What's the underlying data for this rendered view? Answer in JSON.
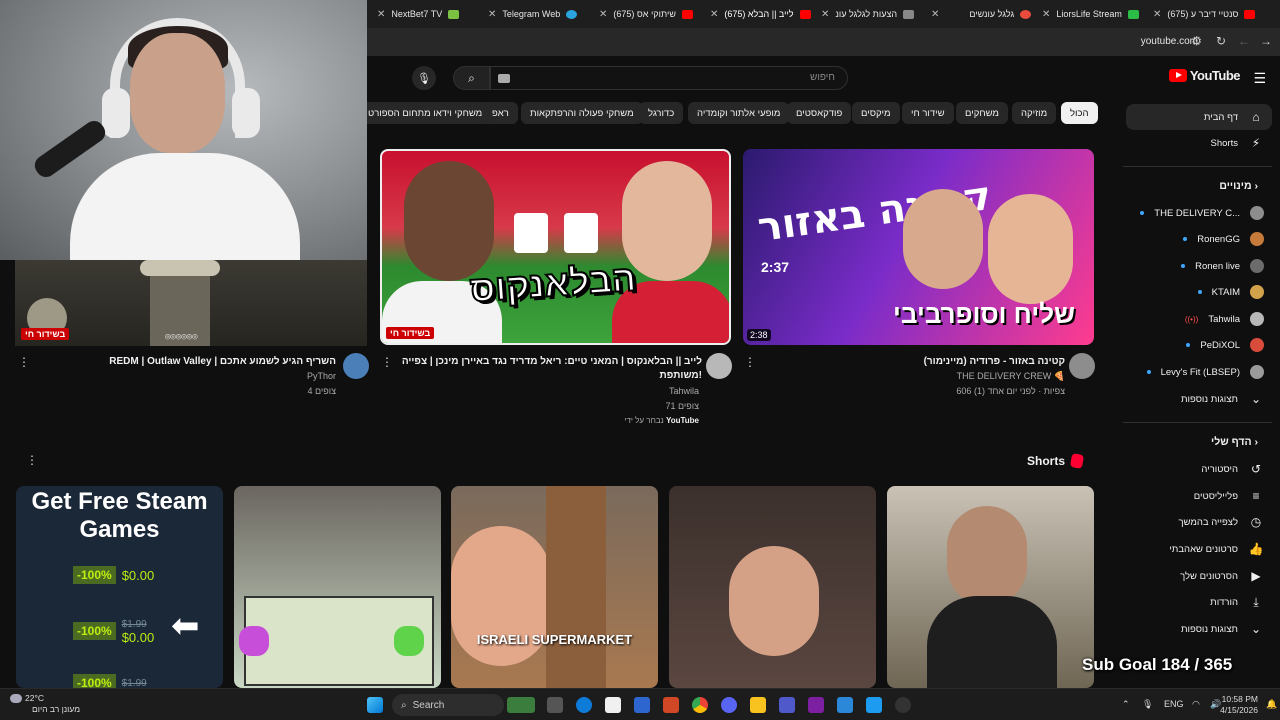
{
  "browser": {
    "tabs": [
      {
        "title": "NextBet7 TV",
        "icon_color": "#7cc242"
      },
      {
        "title": "Telegram Web",
        "icon_color": "#2aa3de"
      },
      {
        "title": "(675) שיתוקי אס",
        "icon_color": "#ff0000"
      },
      {
        "title": "(675) לייב || הבלא",
        "icon_color": "#ff0000"
      },
      {
        "title": "הצעות לגלגל עונ",
        "icon_color": "#888888"
      },
      {
        "title": "גלגל עונשים",
        "icon_color": "#e94b3c"
      },
      {
        "title": "LiorsLife Stream",
        "icon_color": "#2bbd45"
      },
      {
        "title": "(675) סנטיי דיבר ע",
        "icon_color": "#ff0000"
      }
    ],
    "url": "youtube.com"
  },
  "youtube": {
    "logo_text": "YouTube",
    "search_placeholder": "חיפוש",
    "chips": [
      "הכול",
      "מוזיקה",
      "משחקים",
      "שידור חי",
      "מיקסים",
      "פודקאסטים",
      "מופעי אלתור וקומדיה",
      "כדורגל",
      "משחקי פעולה והרפתקאות",
      "ראפ",
      "משחקי וידאו מתחום הספורט"
    ],
    "sidebar": {
      "main": [
        {
          "label": "דף הבית",
          "icon": "home-icon",
          "glyph": "⌂"
        },
        {
          "label": "Shorts",
          "icon": "shorts-icon",
          "glyph": "⚡"
        }
      ],
      "subs_header": "מינויים",
      "subscriptions": [
        {
          "label": "THE DELIVERY C...",
          "color": "#8d8d8d"
        },
        {
          "label": "RonenGG",
          "color": "#c77b3a"
        },
        {
          "label": "Ronen live",
          "color": "#6b6b6b"
        },
        {
          "label": "KTAIM",
          "color": "#d2a24a"
        },
        {
          "label": "Tahwila",
          "color": "#b8b8b8"
        },
        {
          "label": "PeDiXOL",
          "color": "#d94b3b"
        },
        {
          "label": "Levy's Fit (LBSEP)",
          "color": "#9a9a9a"
        }
      ],
      "show_more": "תצוגות נוספות",
      "you_header": "הדף שלי",
      "you_items": [
        {
          "label": "היסטוריה",
          "icon": "history-icon",
          "glyph": "↺"
        },
        {
          "label": "פלייליסטים",
          "icon": "playlist-icon",
          "glyph": "≡"
        },
        {
          "label": "לצפייה בהמשך",
          "icon": "watch-later-icon",
          "glyph": "◷"
        },
        {
          "label": "סרטונים שאהבתי",
          "icon": "like-icon",
          "glyph": "👍"
        },
        {
          "label": "הסרטונים שלך",
          "icon": "your-videos-icon",
          "glyph": "▶"
        },
        {
          "label": "הורדות",
          "icon": "download-icon",
          "glyph": "⤓"
        },
        {
          "label": "תצוגות נוספות",
          "icon": "chevron-down-icon",
          "glyph": "⌄"
        }
      ]
    },
    "videos": [
      {
        "title": "קטינה באזור - פרודיה (מיינימור)",
        "channel": "THE DELIVERY CREW 🍕",
        "meta": "606 צפיות · לפני יום אחד (1)",
        "duration": "2:38",
        "thumb_text": "קטינה באזור",
        "thumb_sub": "שליח וסופרביבי",
        "thumb_time": "2:37"
      },
      {
        "title": "לייב || הבלאנקוס | המאני טיים: ריאל מדריד נגד באיירן מינכן | צפייה משותפת!",
        "channel": "Tahwila",
        "meta": "71 צופים",
        "badge_live": "בשידור חי",
        "thumb_text": "הבלאנקוס",
        "picked_by": "נבחר על ידי",
        "picked_brand": "YouTube"
      },
      {
        "title": "REDM | Outlaw Valley | השריף הגיע לשמוע אתכם",
        "channel": "PyThor",
        "meta": "4 צופים",
        "badge_live": "בשידור חי"
      }
    ],
    "shorts_header": "Shorts",
    "shorts": [
      {
        "label": "",
        "bg": "#5b5b4f"
      },
      {
        "label": "",
        "bg": "#7a5a44"
      },
      {
        "label": "ISRAELI SUPERMARKET",
        "bg": "#8a6b55"
      },
      {
        "label": "",
        "bg": "#a97c62"
      },
      {
        "label": "Get Free Steam Games",
        "bg": "#1b2838"
      }
    ],
    "steam_rows": [
      {
        "pct": "-100%",
        "old": "",
        "price": "$0.00"
      },
      {
        "pct": "-100%",
        "old": "$1.99",
        "price": "$0.00"
      },
      {
        "pct": "-100%",
        "old": "$1.99",
        "price": ""
      }
    ]
  },
  "overlay": {
    "sub_goal": "Sub Goal 184 / 365",
    "live_badge": "בשידור חי"
  },
  "taskbar": {
    "weather_temp": "22°C",
    "weather_desc": "מעונן רב היום",
    "search": "Search",
    "lang": "ENG",
    "time": "10:58 PM",
    "date": "4/15/2026"
  }
}
